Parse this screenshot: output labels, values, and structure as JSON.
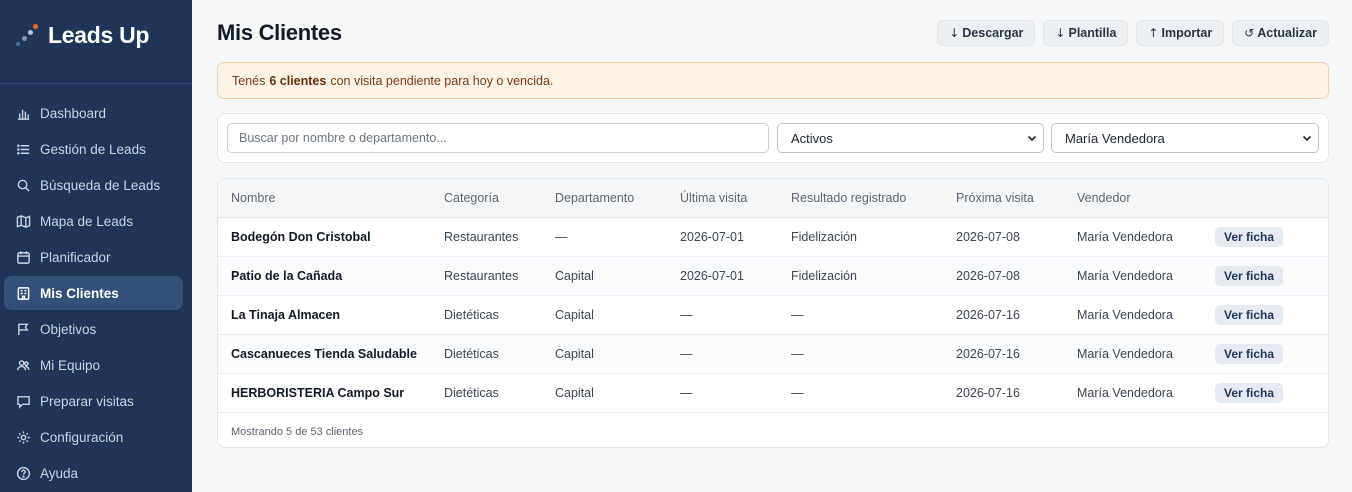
{
  "app": {
    "name": "Leads Up"
  },
  "sidebar": {
    "items": [
      {
        "label": "Dashboard",
        "icon": "bar-chart-icon"
      },
      {
        "label": "Gestión de Leads",
        "icon": "list-icon"
      },
      {
        "label": "Búsqueda de Leads",
        "icon": "search-icon"
      },
      {
        "label": "Mapa de Leads",
        "icon": "map-icon"
      },
      {
        "label": "Planificador",
        "icon": "calendar-icon"
      },
      {
        "label": "Mis Clientes",
        "icon": "building-icon",
        "active": true
      },
      {
        "label": "Objetivos",
        "icon": "flag-icon"
      },
      {
        "label": "Mi Equipo",
        "icon": "team-icon"
      },
      {
        "label": "Preparar visitas",
        "icon": "chat-icon"
      },
      {
        "label": "Configuración",
        "icon": "gear-icon"
      },
      {
        "label": "Ayuda",
        "icon": "help-icon"
      }
    ]
  },
  "page": {
    "title": "Mis Clientes"
  },
  "toolbar": {
    "download": {
      "icon": "↓",
      "label": "Descargar"
    },
    "template": {
      "icon": "↓",
      "label": "Plantilla"
    },
    "import": {
      "icon": "↑",
      "label": "Importar"
    },
    "refresh": {
      "icon": "↺",
      "label": "Actualizar"
    }
  },
  "alert": {
    "prefix": "Tenés",
    "highlight": "6 clientes",
    "suffix": "con visita pendiente para hoy o vencida."
  },
  "filters": {
    "search_placeholder": "Buscar por nombre o departamento...",
    "status_value": "Activos",
    "seller_value": "María Vendedora"
  },
  "table": {
    "columns": [
      "Nombre",
      "Categoría",
      "Departamento",
      "Última visita",
      "Resultado registrado",
      "Próxima visita",
      "Vendedor",
      ""
    ],
    "action_label": "Ver ficha",
    "rows": [
      [
        "Bodegón Don Cristobal",
        "Restaurantes",
        "—",
        "2026-07-01",
        "Fidelización",
        "2026-07-08",
        "María Vendedora"
      ],
      [
        "Patio de la Cañada",
        "Restaurantes",
        "Capital",
        "2026-07-01",
        "Fidelización",
        "2026-07-08",
        "María Vendedora"
      ],
      [
        "La Tinaja Almacen",
        "Dietéticas",
        "Capital",
        "—",
        "—",
        "2026-07-16",
        "María Vendedora"
      ],
      [
        "Cascanueces Tienda Saludable",
        "Dietéticas",
        "Capital",
        "—",
        "—",
        "2026-07-16",
        "María Vendedora"
      ],
      [
        "HERBORISTERIA Campo Sur",
        "Dietéticas",
        "Capital",
        "—",
        "—",
        "2026-07-16",
        "María Vendedora"
      ]
    ],
    "footer": "Mostrando 5 de 53 clientes"
  },
  "colors": {
    "sidebar": "#1e3557",
    "active": "#34507a",
    "alert_bg": "#fdf3e7",
    "brand_accent": "#f26b2a"
  }
}
